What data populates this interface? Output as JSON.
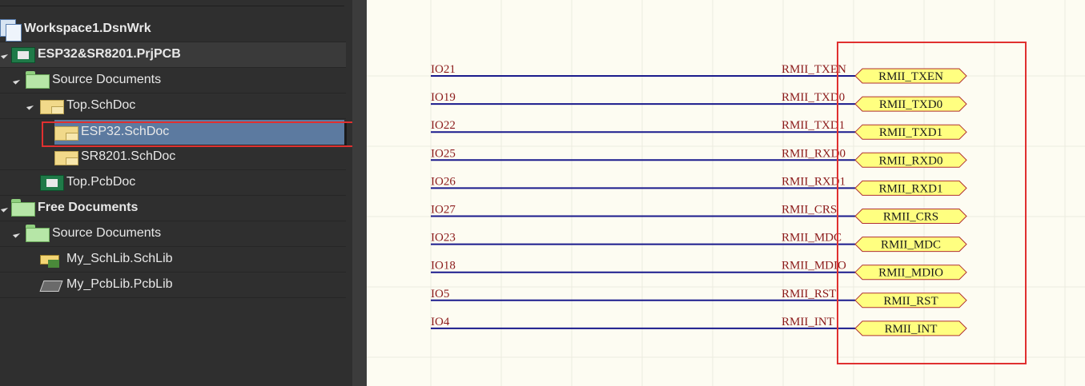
{
  "project_tree": {
    "workspace": "Workspace1.DsnWrk",
    "project": "ESP32&SR8201.PrjPCB",
    "source_documents": "Source Documents",
    "top_sch": "Top.SchDoc",
    "esp32_sch": "ESP32.SchDoc",
    "sr8201_sch": "SR8201.SchDoc",
    "top_pcb": "Top.PcbDoc",
    "free_documents": "Free Documents",
    "free_source_documents": "Source Documents",
    "schlib": "My_SchLib.SchLib",
    "pcblib": "My_PcbLib.PcbLib"
  },
  "schematic": {
    "wires": [
      {
        "net": "IO21",
        "port_net": "RMII_TXEN",
        "port": "RMII_TXEN"
      },
      {
        "net": "IO19",
        "port_net": "RMII_TXD0",
        "port": "RMII_TXD0"
      },
      {
        "net": "IO22",
        "port_net": "RMII_TXD1",
        "port": "RMII_TXD1"
      },
      {
        "net": "IO25",
        "port_net": "RMII_RXD0",
        "port": "RMII_RXD0"
      },
      {
        "net": "IO26",
        "port_net": "RMII_RXD1",
        "port": "RMII_RXD1"
      },
      {
        "net": "IO27",
        "port_net": "RMII_CRS",
        "port": "RMII_CRS"
      },
      {
        "net": "IO23",
        "port_net": "RMII_MDC",
        "port": "RMII_MDC"
      },
      {
        "net": "IO18",
        "port_net": "RMII_MDIO",
        "port": "RMII_MDIO"
      },
      {
        "net": "IO5",
        "port_net": "RMII_RST",
        "port": "RMII_RST"
      },
      {
        "net": "IO4",
        "port_net": "RMII_INT",
        "port": "RMII_INT"
      }
    ]
  },
  "colors": {
    "wire": "#1a1a8c",
    "net_label": "#8b1a1a",
    "port_fill": "#ffff80",
    "port_stroke": "#b03030",
    "highlight_box": "#e03030",
    "selected_row": "#5c7aa0"
  }
}
